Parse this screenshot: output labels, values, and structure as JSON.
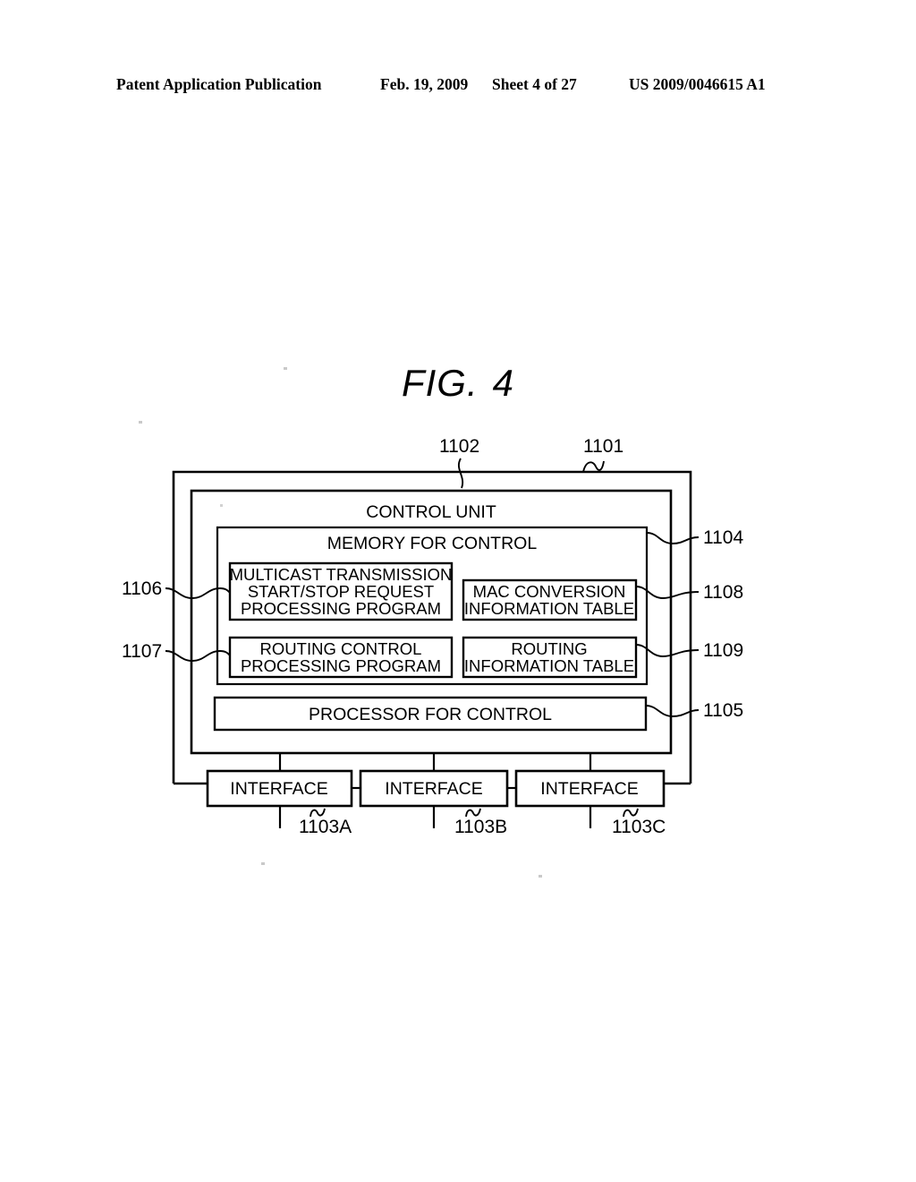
{
  "header": {
    "publication": "Patent Application Publication",
    "date": "Feb. 19, 2009",
    "sheet": "Sheet 4 of 27",
    "patent_number": "US 2009/0046615 A1"
  },
  "figure": {
    "label": "FIG.",
    "number": "4",
    "boxes": {
      "outer_device": "",
      "control_unit": "CONTROL UNIT",
      "memory_for_control": "MEMORY FOR CONTROL",
      "multicast_program_line1": "MULTICAST TRANSMISSION",
      "multicast_program_line2": "START/STOP REQUEST",
      "multicast_program_line3": "PROCESSING PROGRAM",
      "mac_table_line1": "MAC CONVERSION",
      "mac_table_line2": "INFORMATION TABLE",
      "routing_program_line1": "ROUTING CONTROL",
      "routing_program_line2": "PROCESSING PROGRAM",
      "routing_table_line1": "ROUTING",
      "routing_table_line2": "INFORMATION TABLE",
      "processor_for_control": "PROCESSOR FOR CONTROL",
      "interface_a": "INTERFACE",
      "interface_b": "INTERFACE",
      "interface_c": "INTERFACE"
    },
    "reference_numerals": {
      "device": "1101",
      "control_unit": "1102",
      "memory_for_control": "1104",
      "processor_for_control": "1105",
      "multicast_program": "1106",
      "routing_program": "1107",
      "mac_table": "1108",
      "routing_table": "1109",
      "interface_a": "1103A",
      "interface_b": "1103B",
      "interface_c": "1103C"
    }
  },
  "colors": {
    "ink": "#000000",
    "paper": "#ffffff"
  }
}
